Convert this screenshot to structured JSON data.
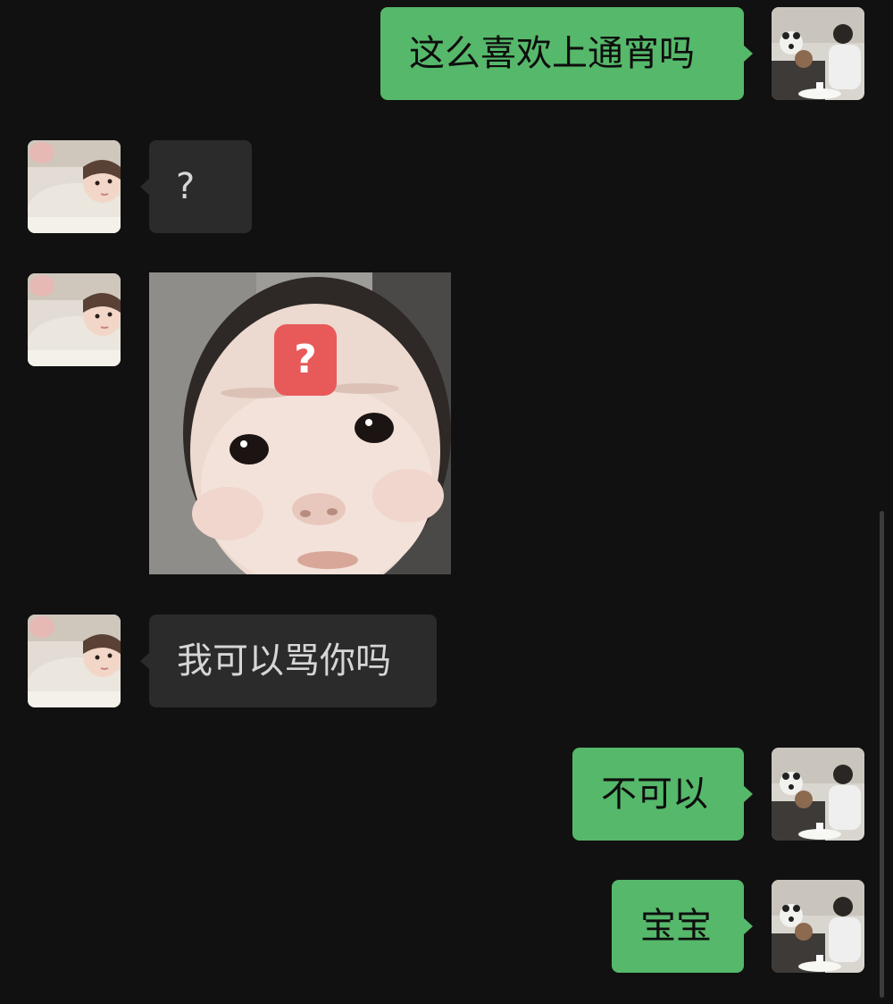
{
  "conversation": {
    "messages": [
      {
        "direction": "outgoing",
        "type": "text",
        "text": "这么喜欢上通宵吗"
      },
      {
        "direction": "incoming",
        "type": "text",
        "text": "?"
      },
      {
        "direction": "incoming",
        "type": "sticker",
        "sticker_name": "baby-face-question-mark-sticker",
        "sticker_badge": "?"
      },
      {
        "direction": "incoming",
        "type": "text",
        "text": "我可以骂你吗"
      },
      {
        "direction": "outgoing",
        "type": "text",
        "text": "不可以"
      },
      {
        "direction": "outgoing",
        "type": "text",
        "text": "宝宝"
      }
    ]
  },
  "theme": {
    "background": "#111111",
    "outgoing_bubble": "#56b86a",
    "incoming_bubble": "#2b2b2b",
    "sticker_badge_color": "#e85a5a"
  }
}
